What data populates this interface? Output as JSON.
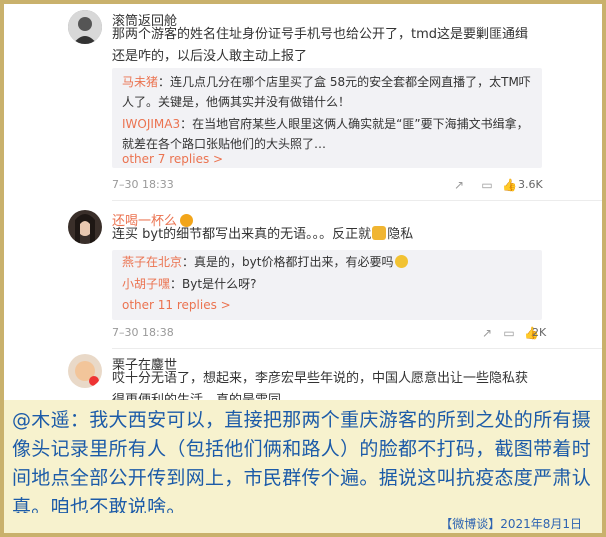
{
  "comments": [
    {
      "user": "滚筒返回舱",
      "text": "那两个游客的姓名住址身份证号手机号也给公开了，tmd这是要剿匪通缉还是咋的，以后没人敢主动上报了",
      "replies": [
        {
          "user": "马未猪",
          "sep": "：",
          "text": "连几点几分在哪个店里买了盒 58元的安全套都全网直播了，太TM吓人了。关键是，他俩其实并没有做错什么！"
        },
        {
          "user": "IWOJIMA3",
          "sep": "：",
          "text": "在当地官府某些人眼里这俩人确实就是“匪”要下海捕文书缉拿，就差在各个路口张贴他们的大头照了…"
        }
      ],
      "more": "other 7 replies >",
      "date": "7–30 18:33",
      "likes": "3.6K"
    },
    {
      "user": "还喝一杯么",
      "text_before": "连买 byt的细节都写出来真的无语。。。反正就",
      "text_after": "隐私",
      "replies": [
        {
          "user": "燕子在北京",
          "sep": "：",
          "text": "真是的，byt价格都打出来，有必要吗"
        },
        {
          "user": "小胡子嘿",
          "sep": "：",
          "text": "Byt是什么呀?"
        }
      ],
      "more": "other 11 replies >",
      "date": "7–30 18:38",
      "likes": "2K"
    },
    {
      "user": "栗子在鏖世",
      "text": "哎十分无语了，想起来，李彦宏早些年说的，中国人愿意出让一些隐私获得更便利的生活。真的是雷同"
    }
  ],
  "caption": "@木遥：我大西安可以，直接把那两个重庆游客的所到之处的所有摄像头记录里所有人（包括他们俩和路人）的脸都不打码，截图带着时间地点全部公开传到网上，市民群传个遍。据说这叫抗疫态度严肃认真。咱也不敢说啥。",
  "footer": "【微博谈】2021年8月1日",
  "icons": [
    "share-icon",
    "comment-icon",
    "like-icon"
  ],
  "colors": {
    "username": "#eb7350",
    "caption_text": "#1c5ba8",
    "caption_bg": "#f7f2ce",
    "border": "#c9b16c"
  }
}
